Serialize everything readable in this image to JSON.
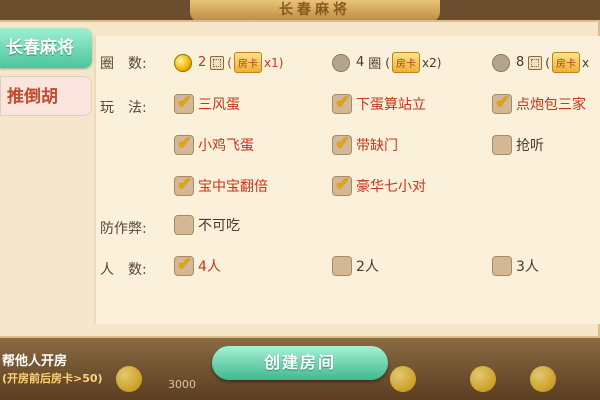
{
  "header": {
    "title": "长春麻将"
  },
  "tabs": [
    {
      "label": "长春麻将"
    },
    {
      "label": "推倒胡"
    }
  ],
  "rows": {
    "quan": {
      "label": "圈　数:",
      "options": [
        {
          "num": "2",
          "unit": "圈",
          "card": "房卡",
          "mult": "x1",
          "selected": true
        },
        {
          "num": "4",
          "unit": "圈",
          "card": "房卡",
          "mult": "x2",
          "selected": false
        },
        {
          "num": "8",
          "unit": "圈",
          "card": "房卡",
          "mult": "x",
          "selected": false
        }
      ]
    },
    "wanfa": {
      "label": "玩　法:",
      "options": [
        {
          "label": "三风蛋",
          "checked": true
        },
        {
          "label": "下蛋算站立",
          "checked": true
        },
        {
          "label": "点炮包三家",
          "checked": true
        },
        {
          "label": "小鸡飞蛋",
          "checked": true
        },
        {
          "label": "带缺门",
          "checked": true
        },
        {
          "label": "抢听",
          "checked": false
        },
        {
          "label": "宝中宝翻倍",
          "checked": true
        },
        {
          "label": "豪华七小对",
          "checked": true
        }
      ]
    },
    "fangzuobi": {
      "label": "防作弊:",
      "options": [
        {
          "label": "不可吃",
          "checked": false
        }
      ]
    },
    "renshu": {
      "label": "人　数:",
      "options": [
        {
          "label": "4人",
          "checked": true
        },
        {
          "label": "2人",
          "checked": false
        },
        {
          "label": "3人",
          "checked": false
        }
      ]
    }
  },
  "footer": {
    "help_label": "帮他人开房",
    "help_sub": "(开房前后房卡>50)",
    "create_label": "创建房间",
    "coins": "3000"
  }
}
